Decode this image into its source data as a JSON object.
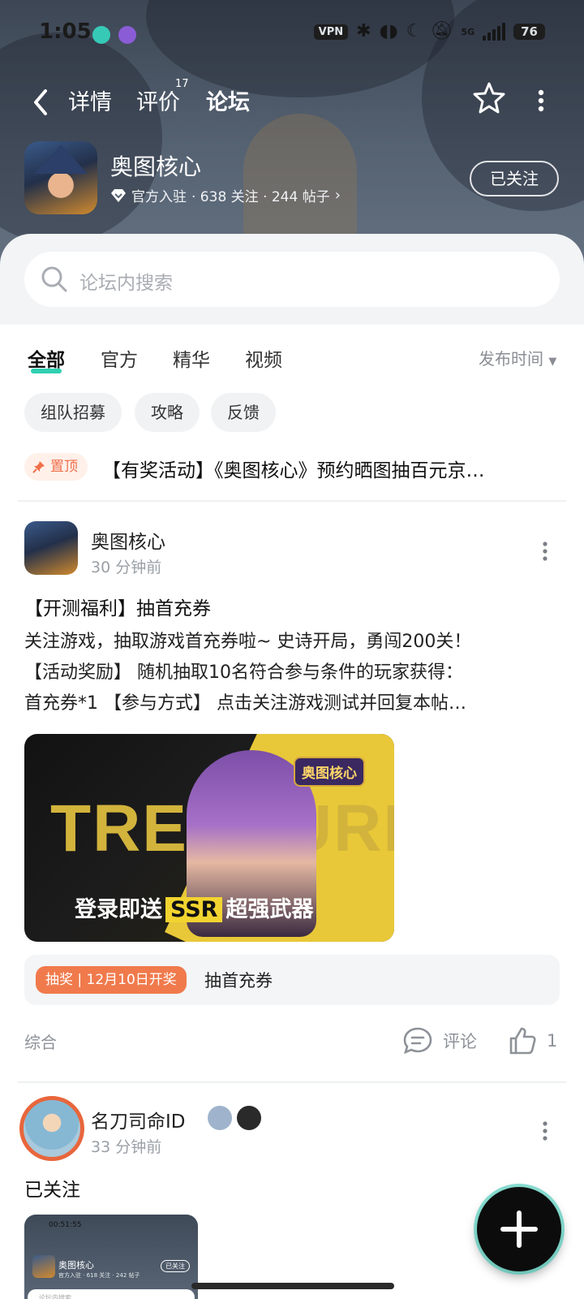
{
  "status_bar": {
    "time": "1:05",
    "vpn": "VPN",
    "network": "5G",
    "battery": "76"
  },
  "nav": {
    "tabs": [
      {
        "label": "详情"
      },
      {
        "label": "评价",
        "count": "17"
      },
      {
        "label": "论坛"
      }
    ],
    "active_tab": "论坛"
  },
  "game": {
    "title": "奥图核心",
    "badge": "官方入驻",
    "meta": "· 638 关注 · 244 帖子",
    "follow_label": "已关注"
  },
  "search": {
    "placeholder": "论坛内搜索"
  },
  "filters": {
    "tabs": [
      {
        "label": "全部"
      },
      {
        "label": "官方"
      },
      {
        "label": "精华"
      },
      {
        "label": "视频"
      }
    ],
    "active": "全部",
    "sort_label": "发布时间"
  },
  "chips": [
    {
      "label": "组队招募"
    },
    {
      "label": "攻略"
    },
    {
      "label": "反馈"
    }
  ],
  "pinned": {
    "badge": "置顶",
    "title": "【有奖活动】《奥图核心》预约晒图抽百元京…"
  },
  "post1": {
    "author": "奥图核心",
    "time": "30 分钟前",
    "title": "【开测福利】抽首充券",
    "body_lines": [
      "关注游戏，抽取游戏首充券啦~ 史诗开局，勇闯200关！",
      "【活动奖励】 随机抽取10名符合参与条件的玩家获得：",
      "首充券*1 【参与方式】 点击关注游戏测试并回复本帖…"
    ],
    "banner": {
      "big_text": "TREASURE",
      "logo_text": "奥图核心",
      "caption_before": "登录即送",
      "caption_highlight": "SSR",
      "caption_after": "超强武器"
    },
    "lottery": {
      "badge": "抽奖 | 12月10日开奖",
      "text": "抽首充券"
    },
    "category": "综合",
    "comment_label": "评论",
    "like_count": "1"
  },
  "post2": {
    "author": "名刀司命ID",
    "time": "33 分钟前",
    "text": "已关注",
    "thumb": {
      "time": "00:51:55",
      "title": "奥图核心",
      "meta": "官方入驻 · 618 关注 · 242 帖子",
      "follow": "已关注",
      "search": "论坛内搜索"
    }
  },
  "colors": {
    "accent": "#2fd0b2",
    "pin": "#f0704a",
    "lottery": "#f07a4c"
  }
}
